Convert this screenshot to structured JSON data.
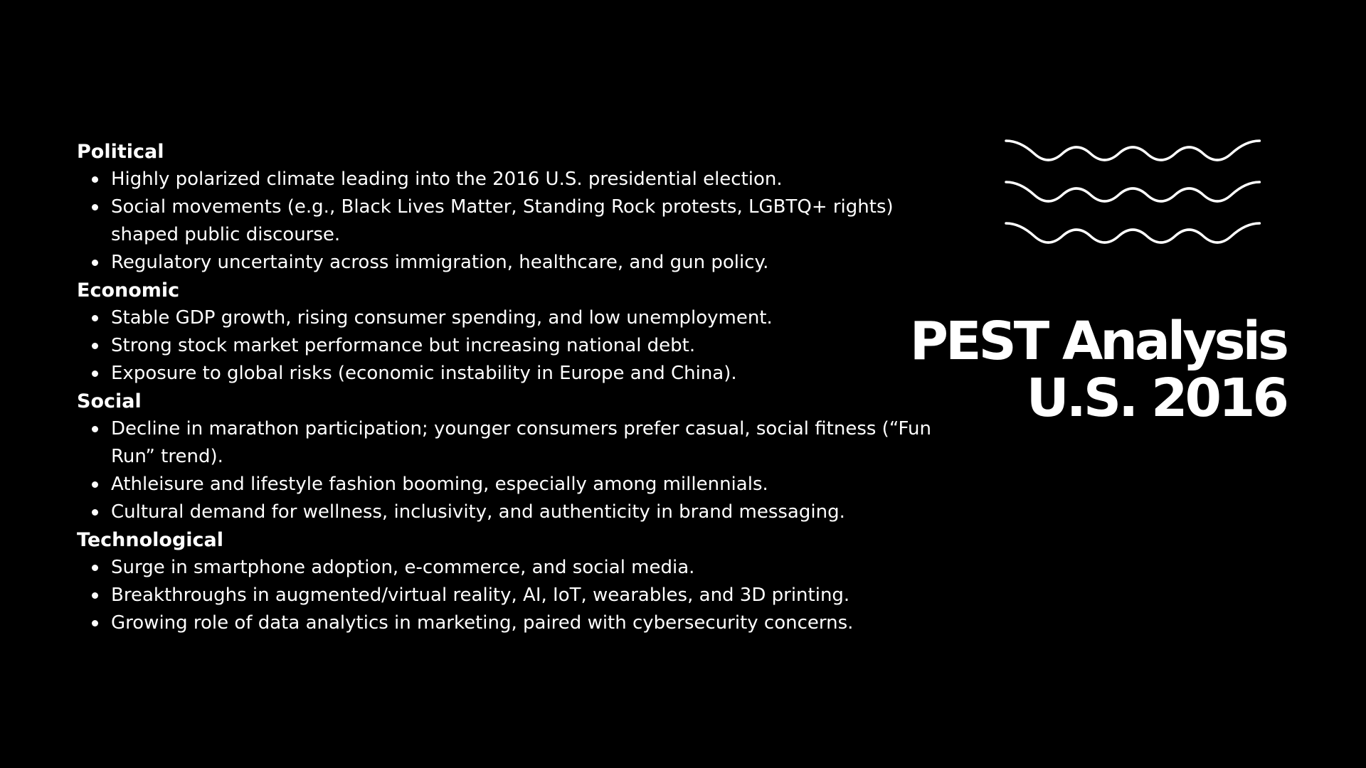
{
  "title": {
    "line1": "PEST Analysis",
    "line2": "U.S. 2016"
  },
  "decoration": {
    "icon": "wavy-lines-icon",
    "color": "#ffffff"
  },
  "colors": {
    "background": "#000000",
    "text": "#ffffff"
  },
  "sections": [
    {
      "heading": "Political",
      "items": [
        "Highly polarized climate leading into the 2016 U.S. presidential election.",
        "Social movements (e.g., Black Lives Matter, Standing Rock protests, LGBTQ+ rights) shaped public discourse.",
        "Regulatory uncertainty across immigration, healthcare, and gun policy."
      ]
    },
    {
      "heading": "Economic",
      "items": [
        "Stable GDP growth, rising consumer spending, and low unemployment.",
        "Strong stock market performance but increasing national debt.",
        "Exposure to global risks (economic instability in Europe and China)."
      ]
    },
    {
      "heading": "Social",
      "items": [
        "Decline in marathon participation; younger consumers prefer casual, social fitness (“Fun Run” trend).",
        "Athleisure and lifestyle fashion booming, especially among millennials.",
        "Cultural demand for wellness, inclusivity, and authenticity in brand messaging."
      ]
    },
    {
      "heading": "Technological",
      "items": [
        "Surge in smartphone adoption, e-commerce, and social media.",
        "Breakthroughs in augmented/virtual reality, AI, IoT, wearables, and 3D printing.",
        "Growing role of data analytics in marketing, paired with cybersecurity concerns."
      ]
    }
  ]
}
